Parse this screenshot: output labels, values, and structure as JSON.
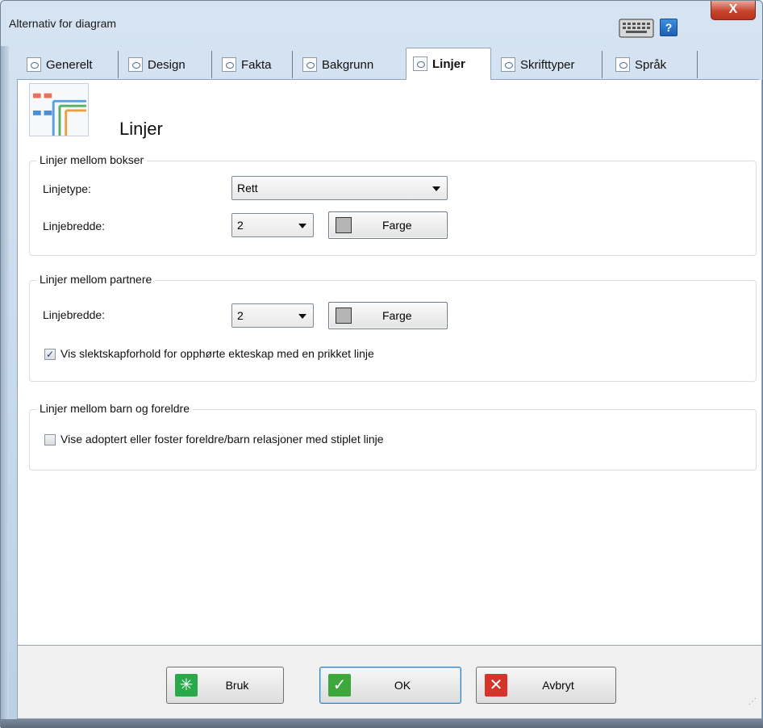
{
  "window": {
    "title": "Alternativ for diagram",
    "help_label": "?",
    "close_label": "X"
  },
  "tabs": [
    {
      "label": "Generelt",
      "active": false
    },
    {
      "label": "Design",
      "active": false
    },
    {
      "label": "Fakta",
      "active": false
    },
    {
      "label": "Bakgrunn",
      "active": false
    },
    {
      "label": "Linjer",
      "active": true
    },
    {
      "label": "Skrifttyper",
      "active": false
    },
    {
      "label": "Språk",
      "active": false
    }
  ],
  "page": {
    "title": "Linjer"
  },
  "group_boxes": {
    "legend": "Linjer mellom bokser",
    "linetype_label": "Linjetype:",
    "linetype_value": "Rett",
    "width_label": "Linjebredde:",
    "width_value": "2",
    "color_button": "Farge"
  },
  "group_partners": {
    "legend": "Linjer mellom partnere",
    "width_label": "Linjebredde:",
    "width_value": "2",
    "color_button": "Farge",
    "checkbox_label": "Vis slektskapforhold for opphørte ekteskap med en prikket linje",
    "checkbox_checked": true
  },
  "group_children": {
    "legend": "Linjer mellom barn og foreldre",
    "checkbox_label": "Vise adoptert eller foster foreldre/barn relasjoner med stiplet linje",
    "checkbox_checked": false
  },
  "footer": {
    "apply_label": "Bruk",
    "ok_label": "OK",
    "cancel_label": "Avbryt"
  },
  "colors": {
    "swatch": "#b5b5b5",
    "apply_icon": "#2aa84a",
    "ok_icon": "#3ca83c",
    "cancel_icon": "#d6342a"
  }
}
